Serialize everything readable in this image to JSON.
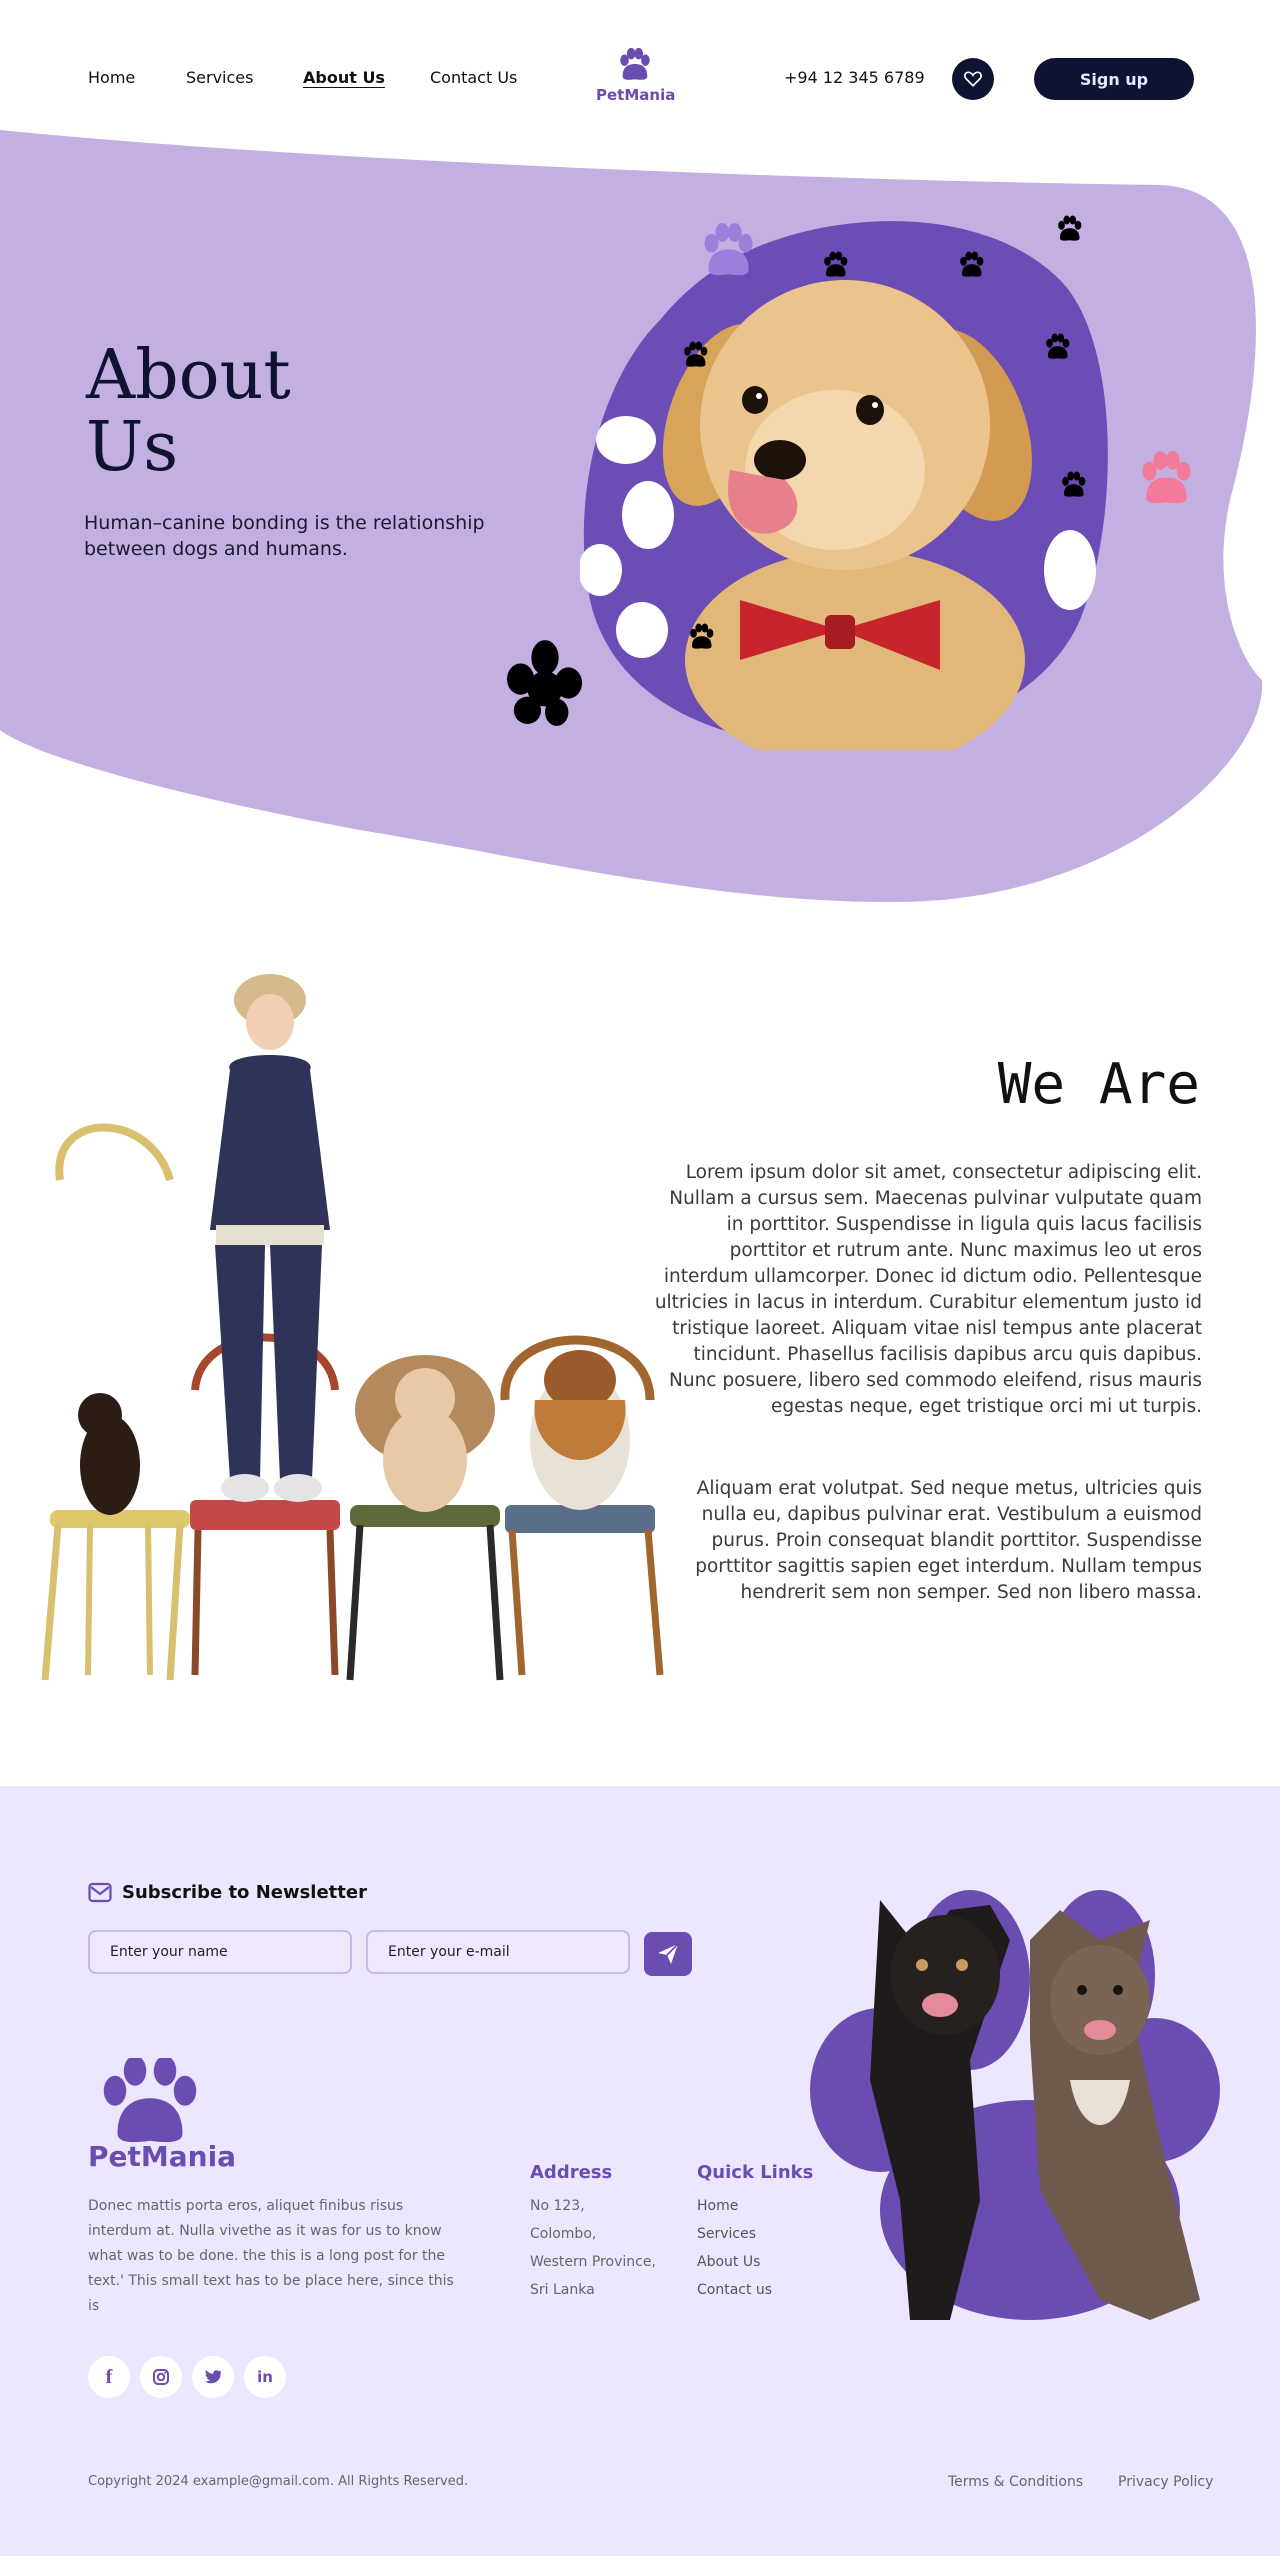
{
  "nav": {
    "links": [
      "Home",
      "Services",
      "About Us",
      "Contact Us"
    ],
    "active": "About Us",
    "brand": "PetMania",
    "phone": "+94 12 345 6789",
    "signup_label": "Sign up"
  },
  "hero": {
    "title_line1": "About",
    "title_line2": "Us",
    "subtitle": "Human–canine bonding is the relationship between dogs and humans."
  },
  "about": {
    "title": "We Are",
    "paragraph1": "Lorem ipsum dolor sit amet, consectetur adipiscing elit. Nullam a cursus sem. Maecenas pulvinar vulputate quam in porttitor. Suspendisse in ligula quis lacus facilisis porttitor et rutrum ante. Nunc maximus leo ut eros interdum ullamcorper. Donec id dictum odio. Pellentesque ultricies in lacus in interdum. Curabitur elementum justo id tristique laoreet. Aliquam vitae nisl tempus ante placerat tincidunt. Phasellus facilisis dapibus arcu quis dapibus. Nunc posuere, libero sed commodo eleifend, risus mauris egestas neque, eget tristique orci mi ut turpis.",
    "paragraph2": "Aliquam erat volutpat. Sed neque metus, ultricies quis nulla eu, dapibus pulvinar erat. Vestibulum a euismod purus. Proin consequat blandit porttitor. Suspendisse porttitor sagittis sapien eget interdum. Nullam tempus hendrerit sem non semper. Sed non libero massa."
  },
  "footer": {
    "newsletter_title": "Subscribe to Newsletter",
    "name_placeholder": "Enter your name",
    "email_placeholder": "Enter your e-mail",
    "brand": "PetMania",
    "description": "Donec mattis porta eros, aliquet finibus risus interdum at. Nulla vivethe as it was for us to know what was to be done. the this is a long  post for the text.' This small text has to be place here, since this is",
    "address_title": "Address",
    "address_lines": [
      "No 123,",
      "Colombo,",
      "Western Province,",
      "Sri Lanka"
    ],
    "quick_links_title": "Quick Links",
    "quick_links": [
      "Home",
      "Services",
      "About Us",
      "Contact us"
    ],
    "social": [
      "facebook-icon",
      "instagram-icon",
      "twitter-icon",
      "linkedin-icon"
    ],
    "copyright": "Copyright 2024 example@gmail.com. All Rights Reserved.",
    "terms": "Terms & Conditions",
    "privacy": "Privacy Policy"
  },
  "colors": {
    "accent": "#6b4cb0",
    "hero_bg": "#c3afe1",
    "footer_bg": "#ede6ff",
    "dark": "#0d1330",
    "pink_paw": "#f47a9a"
  }
}
